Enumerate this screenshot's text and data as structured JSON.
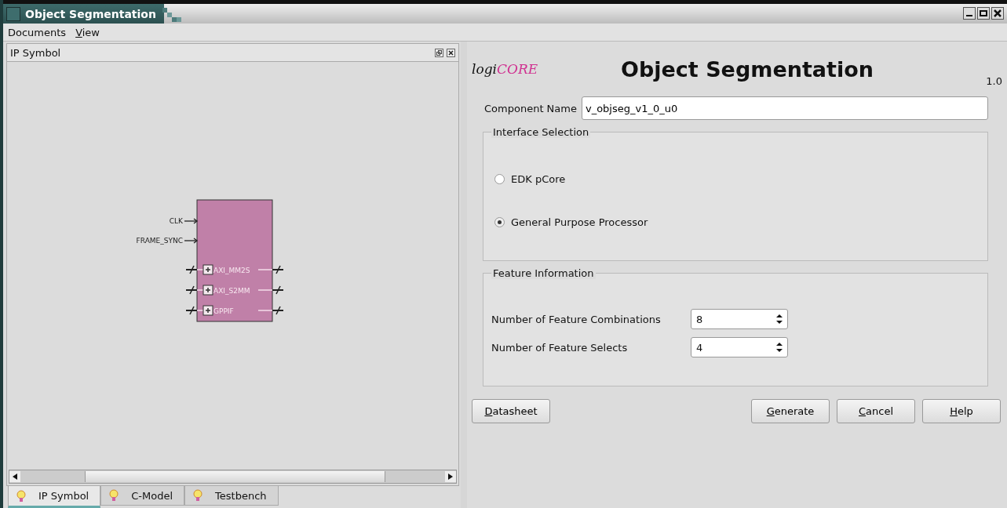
{
  "window": {
    "title": "Object Segmentation"
  },
  "menu": [
    {
      "label": "Documents",
      "mnemonic": false
    },
    {
      "label": "View",
      "mnemonic": true
    }
  ],
  "left_panel": {
    "title": "IP Symbol",
    "symbol": {
      "pins": [
        {
          "kind": "input",
          "label": "CLK"
        },
        {
          "kind": "input",
          "label": "FRAME_SYNC"
        },
        {
          "kind": "bus",
          "label": "AXI_MM2S"
        },
        {
          "kind": "bus",
          "label": "AXI_S2MM"
        },
        {
          "kind": "bus",
          "label": "GPPIF"
        }
      ]
    },
    "tabs": [
      {
        "label": "IP Symbol",
        "selected": true
      },
      {
        "label": "C-Model",
        "selected": false
      },
      {
        "label": "Testbench",
        "selected": false
      }
    ]
  },
  "header": {
    "logo_parts": [
      "logi",
      "CORE"
    ],
    "title": "Object Segmentation",
    "version": "1.0"
  },
  "component_name": {
    "label": "Component Name",
    "value": "v_objseg_v1_0_u0"
  },
  "interface_selection": {
    "title": "Interface Selection",
    "options": [
      {
        "label": "EDK pCore",
        "selected": false
      },
      {
        "label": "General Purpose Processor",
        "selected": true
      }
    ]
  },
  "feature_information": {
    "title": "Feature Information",
    "fields": [
      {
        "label": "Number of Feature Combinations",
        "value": "8"
      },
      {
        "label": "Number of Feature Selects",
        "value": "4"
      }
    ]
  },
  "left_buttons": [
    {
      "label": "Datasheet",
      "mnemonic": true
    }
  ],
  "right_buttons": [
    {
      "label": "Generate",
      "mnemonic": true
    },
    {
      "label": "Cancel",
      "mnemonic": true
    },
    {
      "label": "Help",
      "mnemonic": true
    }
  ]
}
